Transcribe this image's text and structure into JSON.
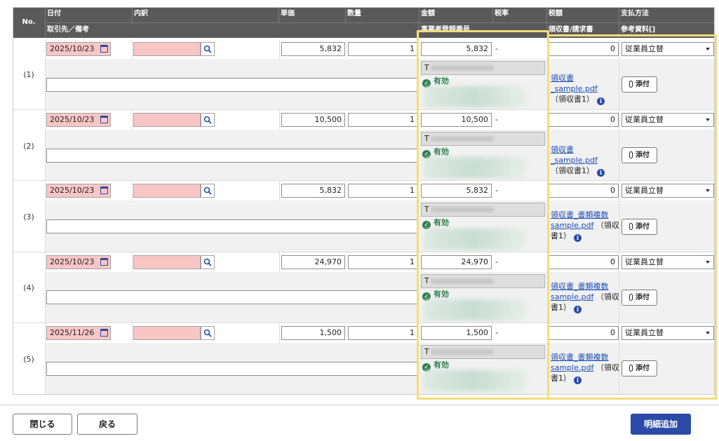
{
  "header": {
    "no": "No.",
    "date": "日付",
    "description": "内訳",
    "unit_price": "単価",
    "quantity": "数量",
    "amount": "金額",
    "tax_rate": "税率",
    "tax_amount": "税額",
    "payment_method": "支払方法",
    "partner_note": "取引先／備考",
    "reg_number": "事業者登録番号",
    "receipt_invoice": "領収書/請求書",
    "attachments": "参考資料[]"
  },
  "rows": [
    {
      "no": "(1)",
      "date": "2025/10/23",
      "unit_price": "5,832",
      "quantity": "1",
      "amount": "5,832",
      "tax_rate": "-",
      "tax": "0",
      "payment": "従業員立替",
      "reg_prefix": "T",
      "status": "有効",
      "file": "領収書_sample.pdf",
      "file_label": "（領収書1）",
      "attach": "添付"
    },
    {
      "no": "(2)",
      "date": "2025/10/23",
      "unit_price": "10,500",
      "quantity": "1",
      "amount": "10,500",
      "tax_rate": "-",
      "tax": "0",
      "payment": "従業員立替",
      "reg_prefix": "T",
      "status": "有効",
      "file": "領収書_sample.pdf",
      "file_label": "（領収書1）",
      "attach": "添付"
    },
    {
      "no": "(3)",
      "date": "2025/10/23",
      "unit_price": "5,832",
      "quantity": "1",
      "amount": "5,832",
      "tax_rate": "-",
      "tax": "0",
      "payment": "従業員立替",
      "reg_prefix": "T",
      "status": "有効",
      "file": "領収書_書類複数sample.pdf",
      "file_label": "（領収書1）",
      "attach": "添付"
    },
    {
      "no": "(4)",
      "date": "2025/10/23",
      "unit_price": "24,970",
      "quantity": "1",
      "amount": "24,970",
      "tax_rate": "-",
      "tax": "0",
      "payment": "従業員立替",
      "reg_prefix": "T",
      "status": "有効",
      "file": "領収書_書類複数sample.pdf",
      "file_label": "（領収書1）",
      "attach": "添付"
    },
    {
      "no": "(5)",
      "date": "2025/11/26",
      "unit_price": "1,500",
      "quantity": "1",
      "amount": "1,500",
      "tax_rate": "-",
      "tax": "0",
      "payment": "従業員立替",
      "reg_prefix": "T",
      "status": "有効",
      "file": "領収書_書類複数sample.pdf",
      "file_label": "（領収書1）",
      "attach": "添付"
    }
  ],
  "footer": {
    "close": "閉じる",
    "back": "戻る",
    "add_detail": "明細追加"
  },
  "colors": {
    "header_bg": "#5a5a5a",
    "required_bg": "#f9c6c6",
    "primary": "#2b4aa8",
    "highlight": "#f4dc7a",
    "valid": "#2e7d4f"
  }
}
